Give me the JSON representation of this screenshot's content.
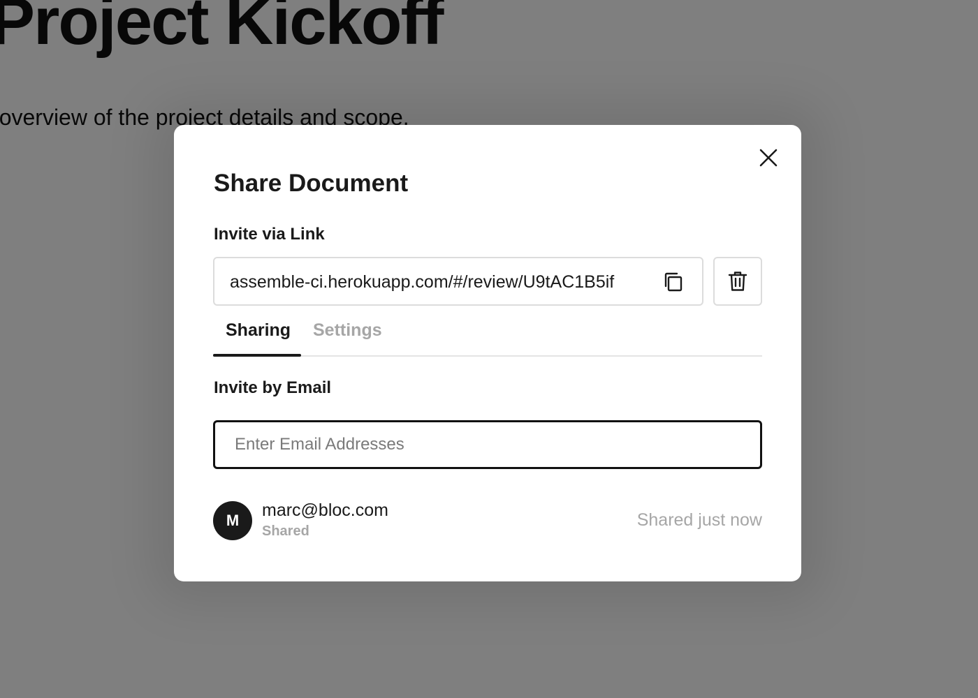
{
  "background": {
    "title": "Project Kickoff",
    "subtitle": "n overview of the project details and scope."
  },
  "modal": {
    "title": "Share Document",
    "close_icon": "close-icon",
    "invite_link": {
      "label": "Invite via Link",
      "url": "assemble-ci.herokuapp.com/#/review/U9tAC1B5if",
      "copy_icon": "copy-icon",
      "delete_icon": "trash-icon"
    },
    "tabs": [
      {
        "label": "Sharing",
        "active": true
      },
      {
        "label": "Settings",
        "active": false
      }
    ],
    "invite_email": {
      "label": "Invite by Email",
      "placeholder": "Enter Email Addresses",
      "value": ""
    },
    "members": [
      {
        "avatar_initial": "M",
        "email": "marc@bloc.com",
        "status": "Shared",
        "time": "Shared just now"
      }
    ]
  },
  "colors": {
    "text_primary": "#1a1a1a",
    "text_muted": "#a6a6a6",
    "border": "#dcdcdc",
    "overlay": "rgba(0,0,0,0.5)"
  }
}
